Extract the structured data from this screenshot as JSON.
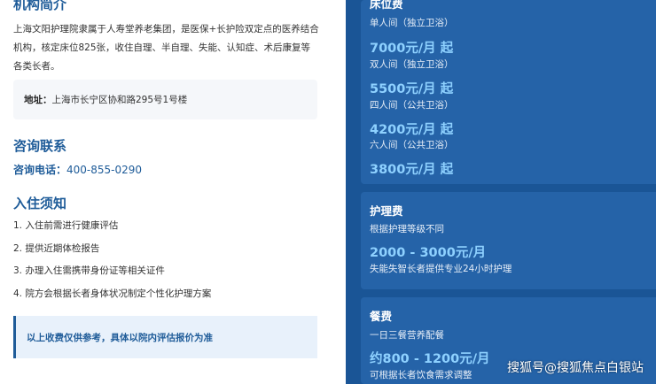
{
  "intro": {
    "title": "机构简介",
    "text": "上海文阳护理院隶属于人寿堂养老集团，是医保+长护险双定点的医养结合机构，核定床位825张，收住自理、半自理、失能、认知症、术后康复等各类长者。"
  },
  "address": {
    "label": "地址：",
    "value": "上海市长宁区协和路295号1号楼"
  },
  "contact": {
    "title": "咨询联系",
    "phone_label": "咨询电话：",
    "phone": "400-855-0290"
  },
  "notes": {
    "title": "入住须知",
    "items": [
      "1. 入住前需进行健康评估",
      "2. 提供近期体检报告",
      "3. 办理入住需携带身份证等相关证件",
      "4. 院方会根据长者身体状况制定个性化护理方案"
    ]
  },
  "disclaimer": "以上收费仅供参考，具体以院内评估报价为准",
  "bed_fee": {
    "title": "床位费",
    "rooms": [
      {
        "type": "单人间（独立卫浴）",
        "price": "7000元/月 起"
      },
      {
        "type": "双人间（独立卫浴）",
        "price": "5500元/月 起"
      },
      {
        "type": "四人间（公共卫浴）",
        "price": "4200元/月 起"
      },
      {
        "type": "六人间（公共卫浴）",
        "price": "3800元/月 起"
      }
    ]
  },
  "care_fee": {
    "title": "护理费",
    "subtitle": "根据护理等级不同",
    "price": "2000 - 3000元/月",
    "note": "失能失智长者提供专业24小时护理"
  },
  "meal_fee": {
    "title": "餐费",
    "subtitle": "一日三餐营养配餐",
    "price": "约800 - 1200元/月",
    "note": "可根据长者饮食需求调整"
  },
  "watermark": "搜狐号@搜狐焦点白银站",
  "colors": {
    "accent": "#1f5c99",
    "panel": "#1a5596",
    "card": "#2563a8",
    "price": "#8ed1ff"
  }
}
